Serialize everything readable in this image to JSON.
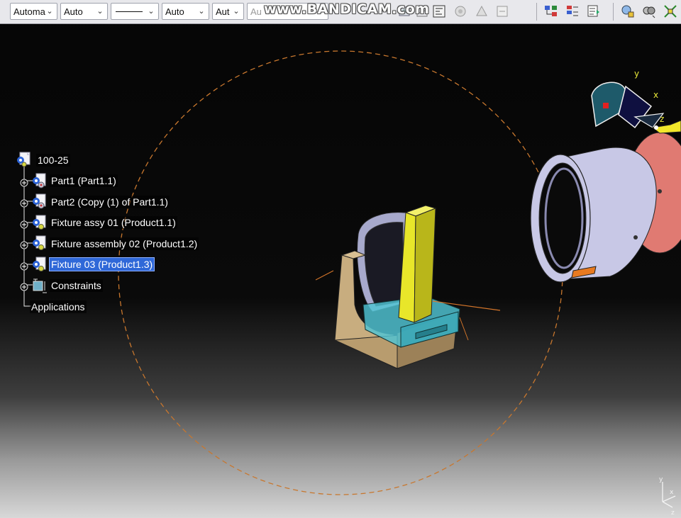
{
  "toolbar": {
    "combos": [
      {
        "value": "Automa",
        "name": "color-combo"
      },
      {
        "value": "Auto",
        "name": "transparency-combo"
      },
      {
        "value": "",
        "name": "linetype-combo"
      },
      {
        "value": "Auto",
        "name": "thickness-combo"
      },
      {
        "value": "Aut",
        "name": "layer-combo"
      },
      {
        "value": "Au",
        "name": "render-combo"
      }
    ],
    "icons": [
      "apply-material-icon",
      "graph-properties-icon",
      "analyze-icon",
      "manipulate-icon",
      "catalog-icon",
      "product-structure-icon",
      "publish-icon",
      "reorder-icon",
      "analysis-tools-icon",
      "clash-icon",
      "snap-icon"
    ]
  },
  "watermark": "www.BANDICAM.com",
  "tree": {
    "root": "100-25",
    "items": [
      {
        "label": "Part1 (Part1.1)",
        "type": "part"
      },
      {
        "label": "Part2 (Copy (1) of Part1.1)",
        "type": "part"
      },
      {
        "label": "Fixture assy 01 (Product1.1)",
        "type": "product"
      },
      {
        "label": "Fixture assembly 02 (Product1.2)",
        "type": "product"
      },
      {
        "label": "Fixture 03 (Product1.3)",
        "type": "product",
        "selected": true
      },
      {
        "label": "Constraints",
        "type": "constraints"
      }
    ],
    "applications": "Applications"
  },
  "compass": {
    "x_label": "x",
    "y_label": "y",
    "z_label": "z"
  },
  "axis_triad": {
    "x_label": "x",
    "y_label": "y",
    "z_label": "z"
  },
  "colors": {
    "selection": "#2f68d8",
    "guide_circle": "#c8772e",
    "bracket_base": "#c8ad7f",
    "bracket_bar": "#e8e62a",
    "cyan_block": "#4fc4d4",
    "ring": "#c8c8e6",
    "salmon_disc": "#e07a72"
  }
}
